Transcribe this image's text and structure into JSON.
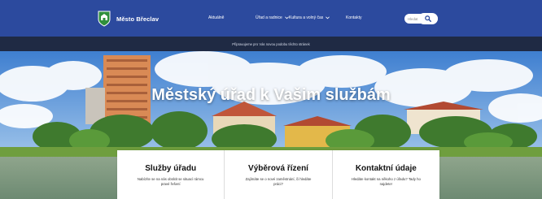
{
  "brand": {
    "name": "Město Břeclav",
    "crest_icon": "city-crest-icon"
  },
  "nav": {
    "items": [
      {
        "label": "Aktuálně",
        "dropdown": false
      },
      {
        "label": "Úřad a radnice",
        "dropdown": true
      },
      {
        "label": "Kultura a volný čas",
        "dropdown": true
      },
      {
        "label": "Kontakty",
        "dropdown": false
      }
    ],
    "search": {
      "placeholder": "Hledat na webu...",
      "icon": "search-icon"
    }
  },
  "info_strip": {
    "text": "Připravujeme pro Vás novou podobu těchto stránek"
  },
  "hero": {
    "title": "Městský úřad k Vašim službám"
  },
  "cards": [
    {
      "title": "Služby úřadu",
      "text": "Nabízíte se na nás obrátit se situací rámcu pravé řešení"
    },
    {
      "title": "Výběrová řízení",
      "text": "Zajímáte se o nové zaměstnání, či hledáte práci?"
    },
    {
      "title": "Kontaktní údaje",
      "text": "Hledáte kontakt na někoho z úřadu? Tady ho najdete!"
    }
  ],
  "colors": {
    "nav_bg": "#2c4a9e",
    "strip_bg": "#1f2a44",
    "card_bg": "#ffffff"
  }
}
